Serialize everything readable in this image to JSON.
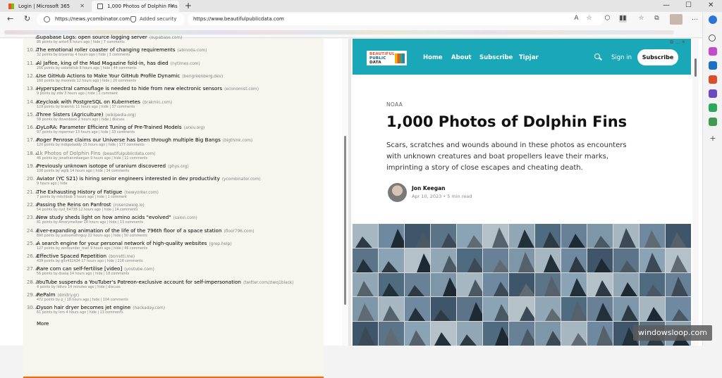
{
  "browser": {
    "tabs": [
      {
        "label": "Login | Microsoft 365"
      },
      {
        "label": "1,000 Photos of Dolphin Fins"
      }
    ],
    "left_url": "https://news.ycombinator.com",
    "left_security": "Added security",
    "right_url": "https://www.beautifulpublicdata.com"
  },
  "hn": {
    "items": [
      {
        "rank": "",
        "title": "Supabase Logs: open source logging server",
        "site": "(supabase.com)",
        "sub": "86 points by ante4 6 hours ago | hide | 7 comments"
      },
      {
        "rank": "10.",
        "title": "The emotional roller coaster of changing requirements",
        "site": "(abinoda.com)",
        "sub": "32 points by bryanray 4 hours ago | hide | 3 comments"
      },
      {
        "rank": "11.",
        "title": "Al Jaffee, king of the Mad Magazine fold-in, has died",
        "site": "(nytimes.com)",
        "sub": "256 points by coloneltcb 8 hours ago | hide | 44 comments"
      },
      {
        "rank": "12.",
        "title": "Use GitHub Actions to Make Your GitHub Profile Dynamic",
        "site": "(bengreenberg.dev)",
        "sub": "160 points by mooreds 12 hours ago | hide | 20 comments"
      },
      {
        "rank": "13.",
        "title": "Hyperspectral camouflage is needed to hide from new electronic sensors",
        "site": "(economist.com)",
        "sub": "9 points by zdw 3 hours ago | hide | 1 comment"
      },
      {
        "rank": "14.",
        "title": "Keycloak with PostgreSQL on Kubernetes",
        "site": "(brakmic.com)",
        "sub": "129 points by brakmic 11 hours ago | hide | 37 comments"
      },
      {
        "rank": "15.",
        "title": "Three Sisters (Agriculture)",
        "site": "(wikipedia.org)",
        "sub": "58 points by dovesbook 2 hours ago | hide | discuss"
      },
      {
        "rank": "16.",
        "title": "DyLoRA: Parameter Efficient Tuning of Pre-Trained Models",
        "site": "(arxiv.org)",
        "sub": "97 points by mpermer 13 hours ago | hide | 33 comments"
      },
      {
        "rank": "17.",
        "title": "Roger Penrose claims our Universe has been through multiple Big Bangs",
        "site": "(bigthink.com)",
        "sub": "120 points by indigodaddy 15 hours ago | hide | 177 comments"
      },
      {
        "rank": "18.",
        "title": "1k Photos of Dolphin Fins",
        "site": "(beautifulpublicdata.com)",
        "sub": "46 points by jonathanmkeegan 9 hours ago | hide | 11 comments",
        "visited": true
      },
      {
        "rank": "19.",
        "title": "Previously unknown isotope of uranium discovered",
        "site": "(phys.org)",
        "sub": "108 points by wglb 14 hours ago | hide | 34 comments"
      },
      {
        "rank": "20.",
        "title": "Aviator (YC S21) is hiring senior engineers interested in dev productivity",
        "site": "(ycombinator.com)",
        "sub": "9 hours ago | hide",
        "noarrow": true
      },
      {
        "rank": "21.",
        "title": "The Exhausting History of Fatigue",
        "site": "(newyorker.com)",
        "sub": "7 points by mitchbob 3 hours ago | hide | 1 comment"
      },
      {
        "rank": "22.",
        "title": "Passing the Reins on Panfrost",
        "site": "(rosenzweig.io)",
        "sub": "54 points by oyd_64738 12 hours ago | hide | 14 comments"
      },
      {
        "rank": "23.",
        "title": "New study sheds light on how amino acids \"evolved\"",
        "site": "(salon.com)",
        "sub": "81 points by Amorymeltzer 14 hours ago | hide | 13 comments"
      },
      {
        "rank": "24.",
        "title": "Ever-expanding animation of the life of the 796th floor of a space station",
        "site": "(floor796.com)",
        "sub": "890 points by justsomehnguy 22 hours ago | hide | 50 comments"
      },
      {
        "rank": "25.",
        "title": "A search engine for your personal network of high-quality websites",
        "site": "(grep.help)",
        "sub": "127 points by zenfounder_man 9 hours ago | hide | 46 comments"
      },
      {
        "rank": "26.",
        "title": "Effective Spaced Repetition",
        "site": "(borretti.me)",
        "sub": "439 points by g0v432A34 17 hours ago | hide | 218 comments"
      },
      {
        "rank": "27.",
        "title": "Rare corn can self-fertilise [video]",
        "site": "(youtube.com)",
        "sub": "56 points by dsalaj 14 hours ago | hide | 18 comments"
      },
      {
        "rank": "28.",
        "title": "YouTube suspends a YouTuber's Patreon-exclusive account for self-impersonation",
        "site": "(twitter.com/ziwq1black)",
        "sub": "4 points by lidlvrs 14 minutes ago | hide | discuss"
      },
      {
        "rank": "29.",
        "title": "RePalm",
        "site": "(dmitry.gr)",
        "sub": "472 points by p_l 18 hours ago | hide | 104 comments"
      },
      {
        "rank": "30.",
        "title": "Dyson hair dryer becomes jet engine",
        "site": "(hackaday.com)",
        "sub": "61 points by lcm 4 hours ago | hide | 13 comments"
      }
    ],
    "more": "More"
  },
  "site": {
    "logo": [
      "BEAUTIFUL",
      "PUBLIC",
      "DATA"
    ],
    "nav": [
      "Home",
      "About",
      "Subscribe",
      "Tipjar"
    ],
    "signin": "Sign in",
    "subscribe": "Subscribe",
    "accent": "#1aa8b9"
  },
  "article": {
    "kicker": "NOAA",
    "title": "1,000 Photos of Dolphin Fins",
    "dek": "Scars, scratches and wounds abound in these photos as encounters with unknown creatures and boat propellers leave their marks, imprinting a story of close escapes and cheating death.",
    "author": "Jon Keegan",
    "meta": "Apr 10, 2023 • 5 min read"
  },
  "watermark": "windowsloop.com"
}
